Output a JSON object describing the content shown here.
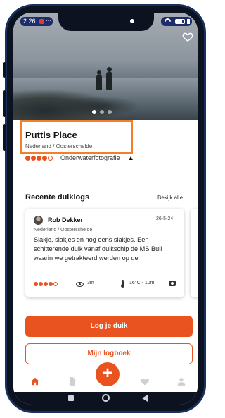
{
  "status": {
    "time": "2:26",
    "notification_more": "···"
  },
  "site": {
    "name": "Puttis Place",
    "location": "Nederland / Oosterschelde",
    "rating_filled": 4,
    "rating_total": 5,
    "rating_label": "Onderwaterfotografie"
  },
  "gallery": {
    "page_count": 3,
    "active_page": 1
  },
  "recent": {
    "title": "Recente duiklogs",
    "see_all": "Bekijk alle",
    "cards": [
      {
        "author": "Rob Dekker",
        "date": "26-5-24",
        "location": "Nederland / Oosterschelde",
        "text": "Slakje, slakjes en nog eens slakjes. Een schitterende duik vanaf duikschip de MS Bull waarin we getrakteerd werden op de",
        "rating_filled": 4,
        "rating_total": 5,
        "visibility": "3m",
        "temp_depth": "16°C - 10m"
      }
    ]
  },
  "actions": {
    "log_dive": "Log je duik",
    "my_logbook": "Mijn logboek"
  },
  "tabbar": {
    "fab_label": "+"
  },
  "colors": {
    "accent": "#e8531f",
    "highlight_box": "#f0802b",
    "status_pill": "#1d2c6b"
  },
  "icons": [
    "heart-outline-icon",
    "home-icon",
    "document-icon",
    "plus-icon",
    "heart-icon",
    "profile-icon",
    "eye-icon",
    "thermometer-icon",
    "camera-icon"
  ]
}
